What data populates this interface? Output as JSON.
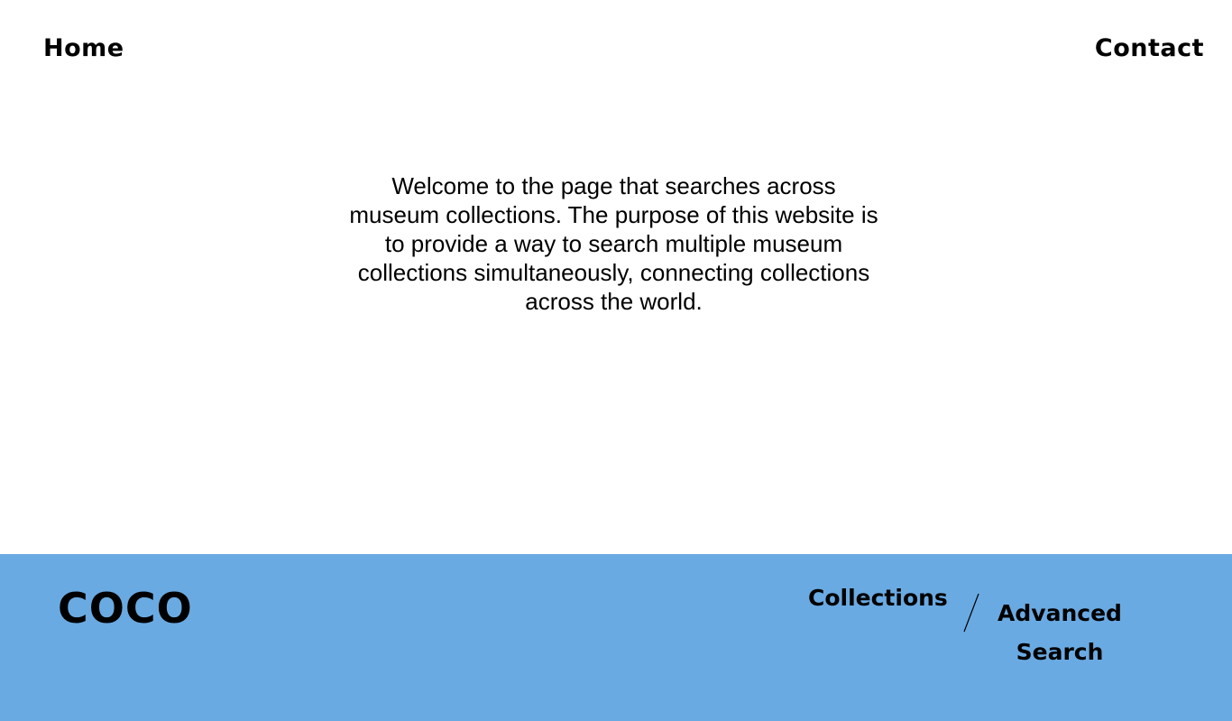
{
  "header": {
    "home_label": "Home",
    "contact_label": "Contact"
  },
  "main": {
    "intro_text": "Welcome to the page that searches across museum collections. The purpose of this website is to provide a way to search multiple museum collections simultaneously, connecting collections across the world."
  },
  "footer": {
    "logo_text": "COCO",
    "collections_label": "Collections",
    "advanced_search_label": "Advanced Search",
    "background_color": "#6aaae2"
  }
}
